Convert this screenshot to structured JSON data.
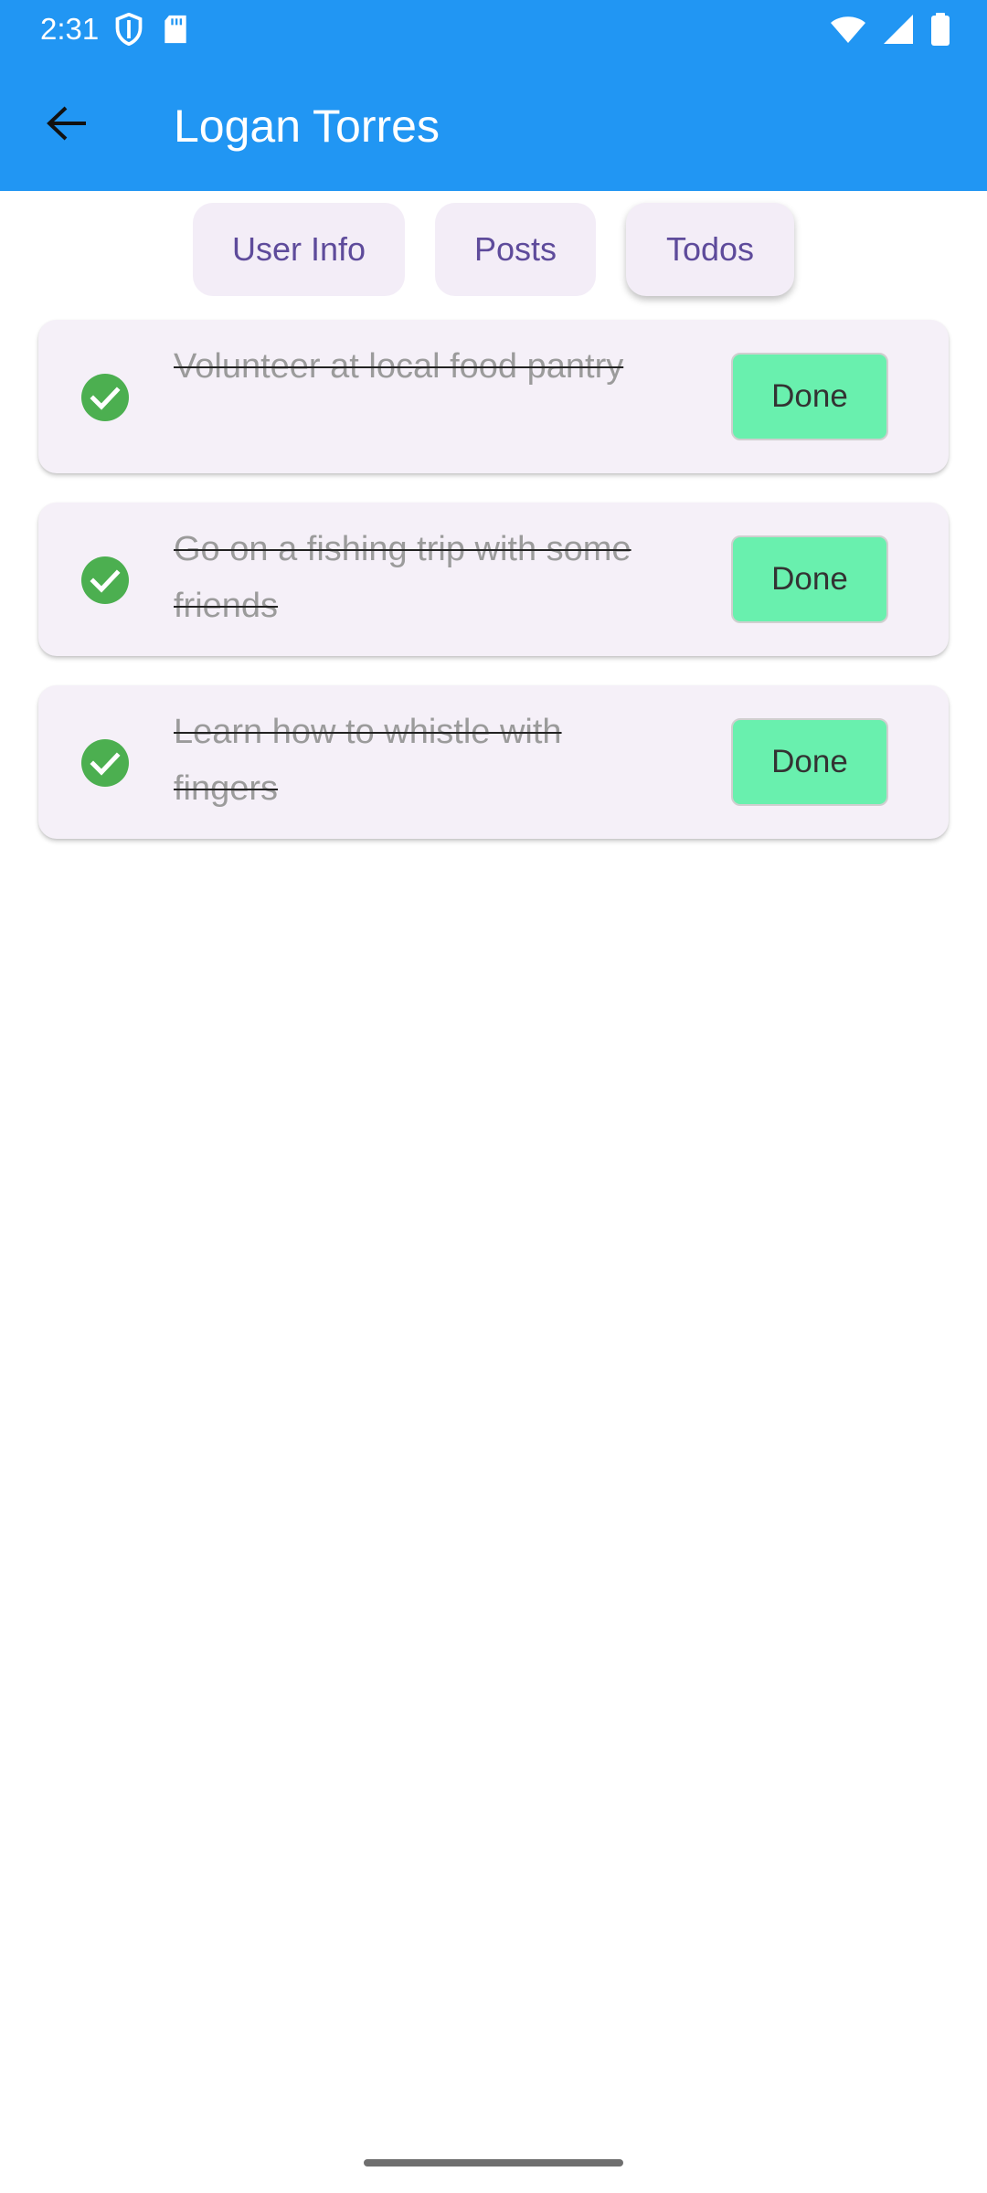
{
  "status_bar": {
    "time": "2:31",
    "icons": [
      "shield-icon",
      "sd-card-icon",
      "wifi-icon",
      "signal-icon",
      "battery-icon"
    ]
  },
  "app_bar": {
    "title": "Logan Torres",
    "back_icon": "arrow-back-icon",
    "color": "#2196F3"
  },
  "tabs": [
    {
      "label": "User Info",
      "selected": false
    },
    {
      "label": "Posts",
      "selected": false
    },
    {
      "label": "Todos",
      "selected": true
    }
  ],
  "todos": [
    {
      "text": "Volunteer at local food pantry",
      "completed": true,
      "button": "Done"
    },
    {
      "text": "Go on a fishing trip with some friends",
      "completed": true,
      "button": "Done"
    },
    {
      "text": "Learn how to whistle with fingers",
      "completed": true,
      "button": "Done"
    }
  ],
  "colors": {
    "done_button": "#69F0AE",
    "check": "#4CAF50",
    "tab_text": "#5E4B9B"
  }
}
